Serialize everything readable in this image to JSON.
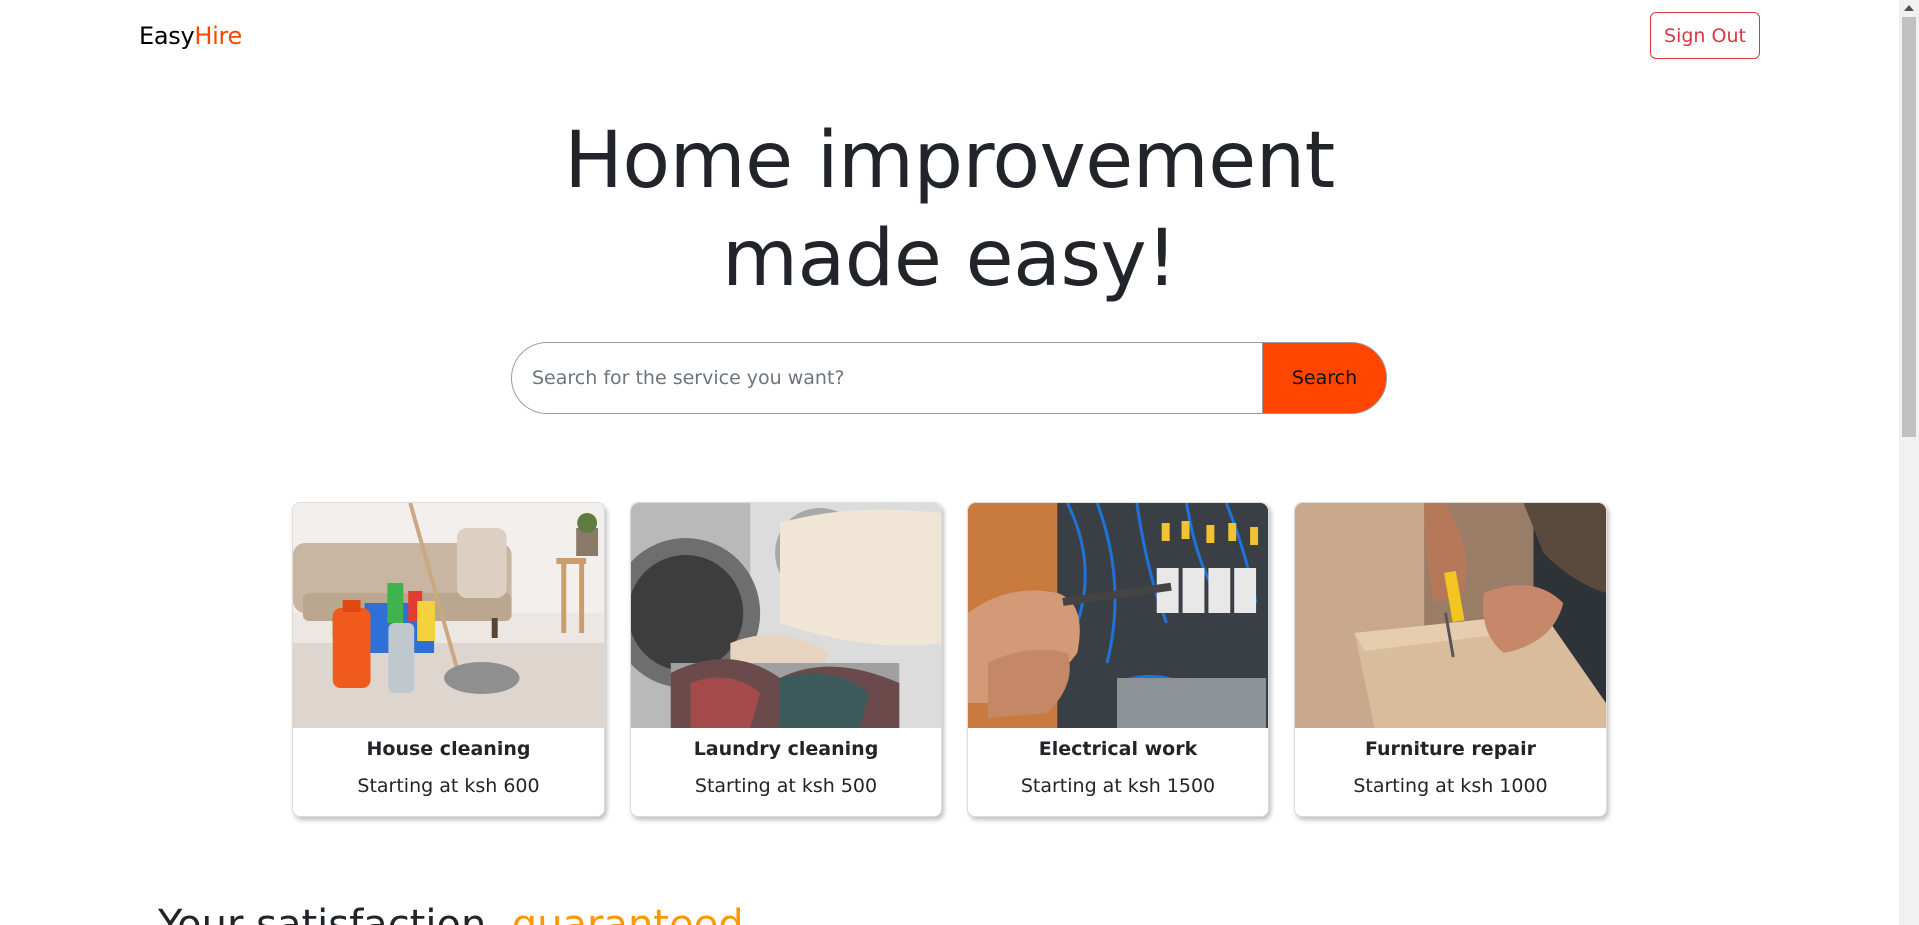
{
  "navbar": {
    "brand_part1": "Easy",
    "brand_part2": "Hire",
    "signout_label": "Sign Out"
  },
  "hero": {
    "title_line1": "Home improvement",
    "title_line2": "made easy!"
  },
  "search": {
    "placeholder": "Search for the service you want?",
    "value": "",
    "button_label": "Search"
  },
  "services": [
    {
      "title": "House cleaning",
      "price": "Starting at ksh 600",
      "image": "house-cleaning-photo"
    },
    {
      "title": "Laundry cleaning",
      "price": "Starting at ksh 500",
      "image": "laundry-photo"
    },
    {
      "title": "Electrical work",
      "price": "Starting at ksh 1500",
      "image": "electrical-photo"
    },
    {
      "title": "Furniture repair",
      "price": "Starting at ksh 1000",
      "image": "furniture-repair-photo"
    }
  ],
  "section": {
    "heading_part1": "Your satisfaction, ",
    "heading_part2": "guaranteed"
  },
  "colors": {
    "accent": "#ff4500",
    "danger": "#dc3545",
    "highlight": "#ff9800"
  }
}
